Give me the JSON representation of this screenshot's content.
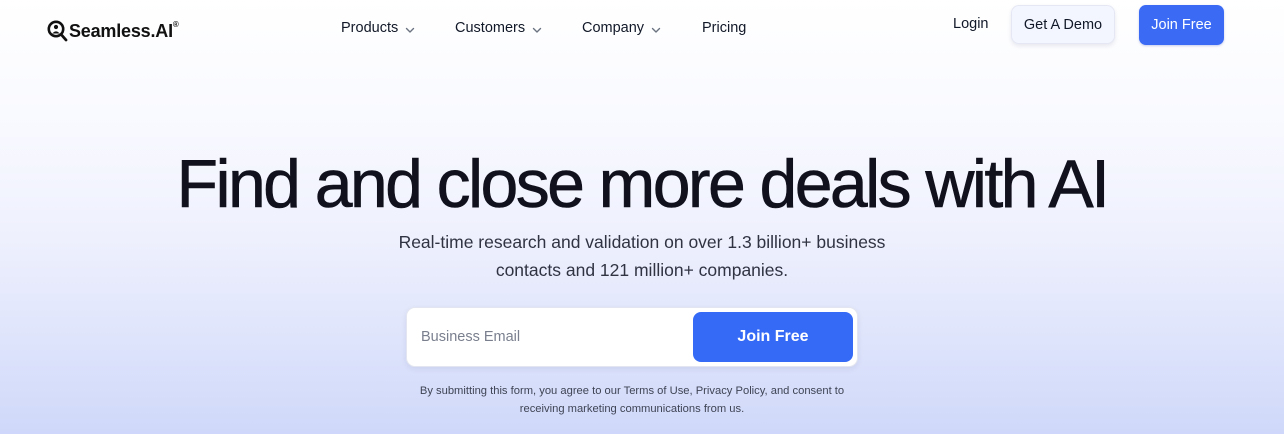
{
  "brand": {
    "name": "Seamless.AI",
    "trademark": "®"
  },
  "nav": {
    "items": [
      {
        "label": "Products",
        "has_dropdown": true,
        "icon": "chevron-down-icon"
      },
      {
        "label": "Customers",
        "has_dropdown": true,
        "icon": "chevron-down-icon"
      },
      {
        "label": "Company",
        "has_dropdown": true,
        "icon": "chevron-down-icon"
      },
      {
        "label": "Pricing",
        "has_dropdown": false
      }
    ],
    "login_label": "Login",
    "demo_label": "Get A Demo",
    "join_label": "Join Free"
  },
  "hero": {
    "title": "Find and close more deals with AI",
    "subtitle_line1": "Real-time research and validation on over 1.3 billion+ business",
    "subtitle_line2": "contacts and 121 million+ companies.",
    "email_placeholder": "Business Email",
    "email_value": "",
    "submit_label": "Join Free",
    "disclaimer_line1": "By submitting this form, you agree to our Terms of Use, Privacy Policy, and consent to",
    "disclaimer_line2": "receiving marketing communications from us."
  },
  "colors": {
    "primary": "#356af6",
    "text": "#111827",
    "demo_bg": "#f4f6ff",
    "gradient_end": "#cfd8fa"
  }
}
